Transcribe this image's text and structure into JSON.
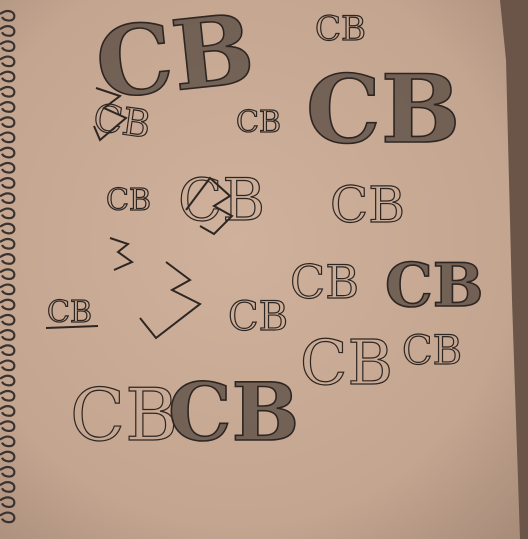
{
  "image": {
    "subject": "sketchbook-page",
    "colors": {
      "paper": "#c9ab96",
      "paper_shadow": "#a98d7a",
      "background": "#5f4c40",
      "ink": "#2e2622",
      "spiral": "#3a322e"
    }
  },
  "sketches": [
    {
      "text": "CB"
    },
    {
      "text": "CB"
    },
    {
      "text": "CB"
    },
    {
      "text": "CB"
    },
    {
      "text": "CB"
    },
    {
      "text": "CB"
    },
    {
      "text": "CB"
    },
    {
      "text": "CB"
    },
    {
      "text": "CB"
    },
    {
      "text": "CB"
    },
    {
      "text": "CB"
    },
    {
      "text": "CB"
    },
    {
      "text": "CB"
    },
    {
      "text": "CB"
    },
    {
      "text": "CB"
    },
    {
      "text": "CB"
    }
  ]
}
